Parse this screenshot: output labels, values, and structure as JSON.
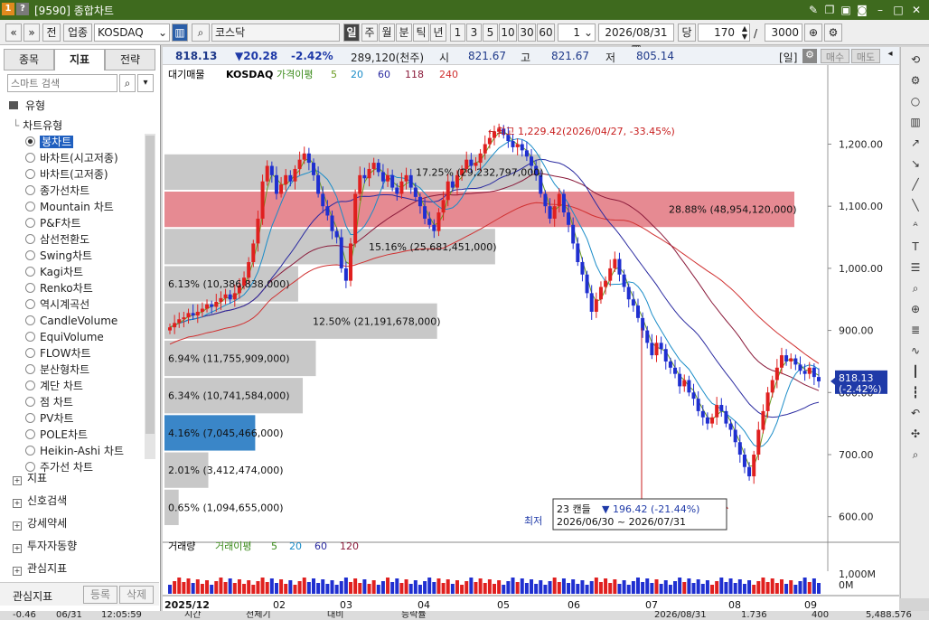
{
  "window": {
    "code": "[9590]",
    "title": "종합차트",
    "badge1": "1",
    "badge2": "?"
  },
  "toolbar": {
    "nav_prev": "«",
    "nav_next": "»",
    "btn_jeon": "전",
    "market": "업종",
    "index_code": "KOSDAQ",
    "index_name": "코스닥",
    "periods": [
      "일",
      "주",
      "월",
      "분",
      "틱",
      "년"
    ],
    "period_active": "일",
    "nums": [
      "1",
      "3",
      "5",
      "10",
      "30",
      "60"
    ],
    "interval": "1",
    "date": "2026/08/31",
    "unit": "당",
    "count": "170",
    "total": "3000",
    "slash": "/"
  },
  "left": {
    "tabs": [
      "종목",
      "지표",
      "전략"
    ],
    "active_tab": "지표",
    "search_placeholder": "스마트 검색",
    "section": "유형",
    "subsection": "차트유형",
    "selected": "봉차트",
    "chart_types": [
      "봉차트",
      "바차트(시고저종)",
      "바차트(고저종)",
      "종가선차트",
      "Mountain 차트",
      "P&F차트",
      "삼선전환도",
      "Swing차트",
      "Kagi차트",
      "Renko차트",
      "역시계곡선",
      "CandleVolume",
      "EquiVolume",
      "FLOW차트",
      "분산형차트",
      "계단 차트",
      "점 차트",
      "PV차트",
      "POLE차트",
      "Heikin-Ashi 차트",
      "주가선 차트"
    ],
    "groups": [
      "지표",
      "신호검색",
      "강세약세",
      "투자자동향",
      "관심지표"
    ],
    "footer_label": "관심지표",
    "register": "등록",
    "delete": "삭제"
  },
  "info": {
    "price": "818.13",
    "change": "▼20.28",
    "pct": "-2.42%",
    "volume": "289,120(천주)",
    "open_label": "시",
    "open": "821.67",
    "high_label": "고",
    "high": "821.67",
    "low_label": "저",
    "low": "805.14",
    "mode": "[일]",
    "sell": "매수",
    "buy": "매도"
  },
  "chart_data": {
    "type": "candlestick",
    "legend": {
      "main": "대기매물",
      "index": "KOSDAQ",
      "ma_label": "가격이평",
      "mas": [
        "5",
        "20",
        "60",
        "118",
        "240"
      ]
    },
    "ma_colors": {
      "5": "#6a9a1e",
      "20": "#1a8cc8",
      "60": "#2a2aa0",
      "118": "#8a1a3a",
      "240": "#d03030"
    },
    "y_ticks": [
      "1,200.00",
      "1,100.00",
      "1,000.00",
      "900.00",
      "800.00",
      "700.00",
      "600.00"
    ],
    "ylim": [
      585,
      1240
    ],
    "x_labels": [
      "2025/12",
      "02",
      "03",
      "04",
      "05",
      "06",
      "07",
      "08",
      "09"
    ],
    "volume_profile": [
      {
        "label": "0.65% (1,094,655,000)",
        "lo": 585,
        "hi": 645,
        "pct": 0.65
      },
      {
        "label": "2.01% (3,412,474,000)",
        "lo": 645,
        "hi": 705,
        "pct": 2.01
      },
      {
        "label": "4.16% (7,045,466,000)",
        "lo": 705,
        "hi": 765,
        "pct": 4.16
      },
      {
        "label": "6.34% (10,741,584,000)",
        "lo": 765,
        "hi": 825,
        "pct": 6.34
      },
      {
        "label": "6.94% (11,755,909,000)",
        "lo": 825,
        "hi": 885,
        "pct": 6.94
      },
      {
        "label": "12.50% (21,191,678,000)",
        "lo": 885,
        "hi": 945,
        "pct": 12.5
      },
      {
        "label": "6.13% (10,386,838,000)",
        "lo": 945,
        "hi": 1005,
        "pct": 6.13
      },
      {
        "label": "15.16% (25,681,451,000)",
        "lo": 1005,
        "hi": 1065,
        "pct": 15.16
      },
      {
        "label": "28.88% (48,954,120,000)",
        "lo": 1065,
        "hi": 1125,
        "pct": 28.88
      },
      {
        "label": "17.25% (29,232,797,000)",
        "lo": 1125,
        "hi": 1185,
        "pct": 17.25
      }
    ],
    "high_annot": "←최고 1,229.42(2026/04/27, -33.45%)",
    "low_label": "최저",
    "low_box_line1": "23 캔들",
    "low_box_drop": "▼ 196.42 (-21.44%)",
    "low_box_line2": "2026/06/30 ~ 2026/07/31",
    "last_price": "818.13",
    "last_pct": "(-2.42%)",
    "closes": [
      905,
      912,
      918,
      921,
      928,
      924,
      930,
      935,
      942,
      938,
      946,
      952,
      958,
      950,
      960,
      972,
      985,
      1010,
      1040,
      1080,
      1140,
      1165,
      1150,
      1120,
      1135,
      1150,
      1140,
      1160,
      1175,
      1185,
      1170,
      1150,
      1120,
      1100,
      1085,
      1060,
      1050,
      1000,
      980,
      1040,
      1120,
      1150,
      1145,
      1160,
      1170,
      1155,
      1140,
      1150,
      1130,
      1120,
      1140,
      1150,
      1130,
      1115,
      1100,
      1080,
      1070,
      1060,
      1090,
      1110,
      1140,
      1130,
      1150,
      1160,
      1175,
      1165,
      1170,
      1185,
      1200,
      1210,
      1220,
      1225,
      1215,
      1205,
      1195,
      1200,
      1190,
      1180,
      1165,
      1150,
      1120,
      1100,
      1080,
      1100,
      1120,
      1090,
      1070,
      1040,
      1010,
      990,
      960,
      930,
      950,
      970,
      980,
      1000,
      1015,
      990,
      970,
      950,
      940,
      920,
      900,
      880,
      860,
      880,
      870,
      850,
      840,
      830,
      810,
      820,
      800,
      790,
      770,
      760,
      750,
      760,
      780,
      770,
      750,
      740,
      720,
      700,
      680,
      665,
      700,
      740,
      770,
      800,
      820,
      840,
      860,
      850,
      855,
      845,
      835,
      830,
      840,
      825,
      818
    ],
    "volume_ma_legend": {
      "main": "거래량",
      "ma_label": "거래이평",
      "mas": [
        "5",
        "20",
        "60",
        "120"
      ]
    },
    "volume_ticks": [
      "1,000M",
      "0M"
    ]
  },
  "right_tools": [
    "refresh-icon",
    "gear-icon",
    "circle-icon",
    "chart-icon",
    "trend-icon",
    "ray-icon",
    "line-icon",
    "line2-icon",
    "auto-icon",
    "text-icon",
    "pattern-icon",
    "zoom-icon",
    "zoom-plus-icon",
    "fib-icon",
    "wave-icon",
    "bars-icon",
    "bars2-icon",
    "undo-icon",
    "magnet-icon",
    "search-icon"
  ],
  "status": {
    "a": "-0.46",
    "b": "06/31",
    "c": "12:05:59",
    "d": "시간",
    "e": "전체기",
    "f": "대비",
    "g": "등락률",
    "h": "2026/08/31",
    "i": "1.736",
    "j": "400",
    "k": "5,488.576"
  }
}
